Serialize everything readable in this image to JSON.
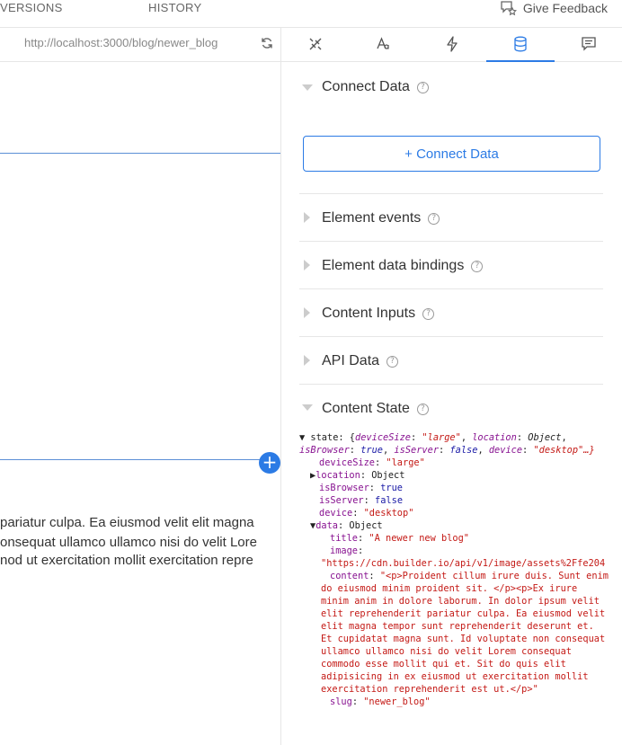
{
  "topbar": {
    "tab_versions": "VERSIONS",
    "tab_history": "HISTORY",
    "feedback_label": "Give Feedback"
  },
  "urlbar": {
    "url": "http://localhost:3000/blog/newer_blog"
  },
  "canvas": {
    "lines": [
      "pariatur culpa. Ea eiusmod velit elit magna",
      "onsequat ullamco ullamco nisi do velit Lore",
      "nod ut exercitation mollit exercitation repre"
    ],
    "add_symbol": "+"
  },
  "panel": {
    "tabs": [
      "style-tab",
      "typography-tab",
      "interactions-tab",
      "data-tab",
      "comments-tab"
    ],
    "connect": {
      "title": "Connect Data",
      "button": "+ Connect Data"
    },
    "sections": [
      "Element events",
      "Element data bindings",
      "Content Inputs",
      "API Data",
      "Content State"
    ]
  },
  "state": {
    "summary_prefix": "state: {",
    "summary_k1": "deviceSize",
    "summary_v1": "\"large\"",
    "summary_k2": "location",
    "summary_v2": "Object",
    "summary_k3": "isBrowser",
    "summary_v3": "true",
    "summary_k4": "isServer",
    "summary_v4": "false",
    "summary_k5": "device",
    "summary_v5": "\"desktop\"…}",
    "deviceSize_key": "deviceSize",
    "deviceSize_val": "\"large\"",
    "location_key": "location",
    "location_val": "Object",
    "isBrowser_key": "isBrowser",
    "isBrowser_val": "true",
    "isServer_key": "isServer",
    "isServer_val": "false",
    "device_key": "device",
    "device_val": "\"desktop\"",
    "data_key": "data",
    "data_val": "Object",
    "title_key": "title",
    "title_val": "\"A newer new blog\"",
    "image_key": "image",
    "image_val": "\"https://cdn.builder.io/api/v1/image/assets%2Ffe204",
    "content_key": "content",
    "content_val": "\"<p>Proident cillum irure duis. Sunt enim do eiusmod minim proident sit. </p><p>Ex irure minim anim in dolore laborum. In dolor ipsum velit elit reprehenderit pariatur culpa. Ea eiusmod velit elit magna tempor sunt reprehenderit deserunt et. Et cupidatat magna sunt. Id voluptate non consequat ullamco ullamco nisi do velit Lorem consequat commodo esse mollit qui et. Sit do quis elit adipisicing in ex eiusmod ut exercitation mollit exercitation reprehenderit est ut.</p>\"",
    "slug_key": "slug",
    "slug_val": "\"newer_blog\""
  },
  "colors": {
    "accent": "#2c7be5",
    "border": "#e6e6e6"
  }
}
